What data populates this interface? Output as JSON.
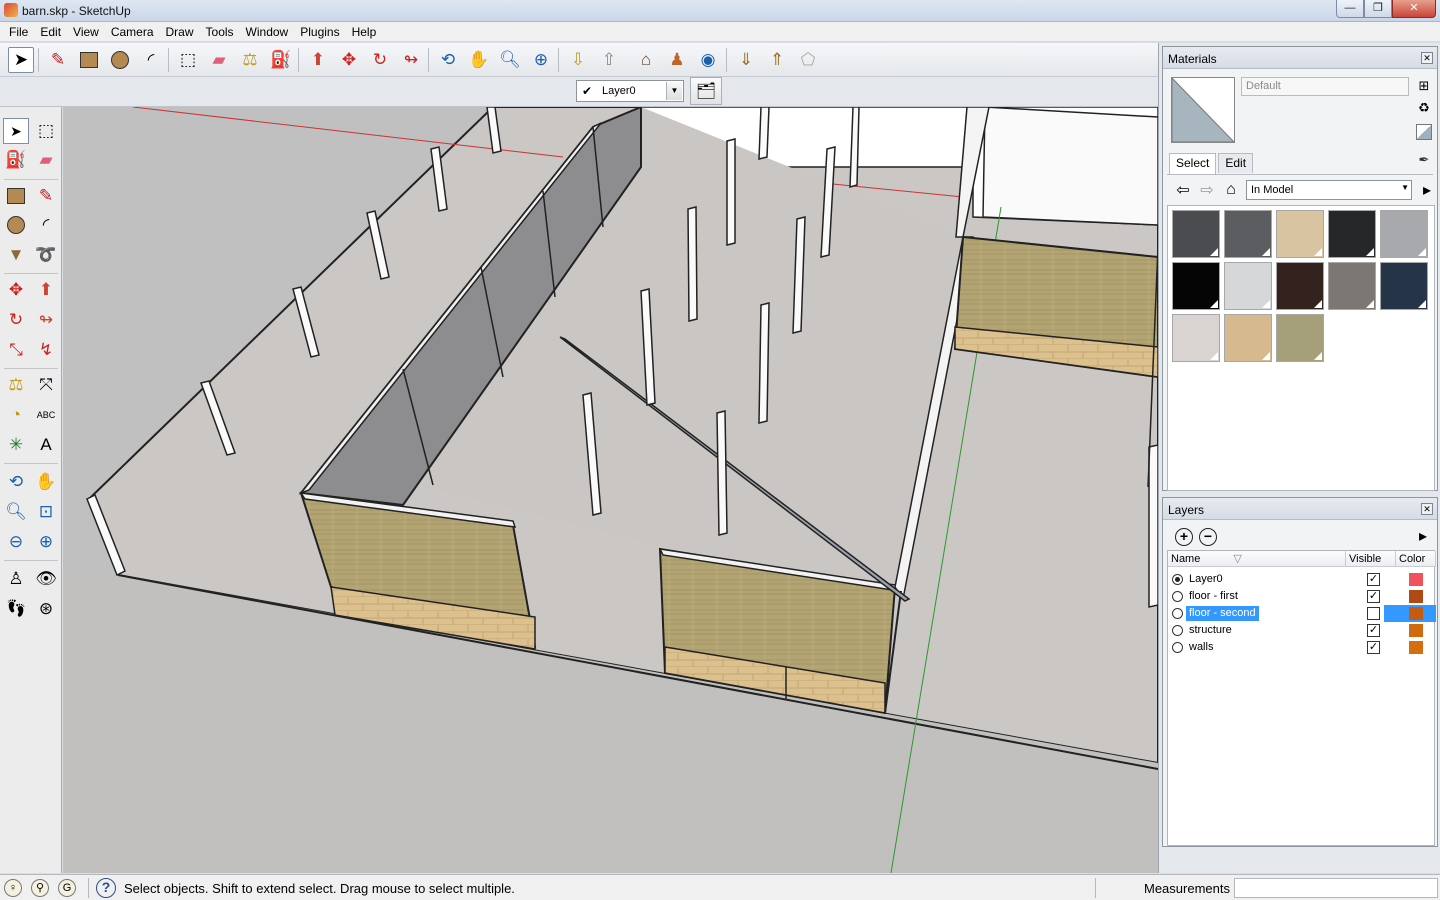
{
  "window": {
    "title": "barn.skp - SketchUp",
    "buttons": {
      "minimize": "—",
      "maximize": "❐",
      "close": "✕"
    }
  },
  "menu": [
    "File",
    "Edit",
    "View",
    "Camera",
    "Draw",
    "Tools",
    "Window",
    "Plugins",
    "Help"
  ],
  "toolbar": {
    "buttons": [
      {
        "name": "select-tool",
        "icon": "arrow"
      },
      {
        "name": "line-tool",
        "icon": "pencil"
      },
      {
        "name": "rectangle-tool",
        "icon": "rectangle"
      },
      {
        "name": "circle-tool",
        "icon": "circle"
      },
      {
        "name": "arc-tool",
        "icon": "arc"
      },
      {
        "name": "make-component-tool",
        "icon": "component"
      },
      {
        "name": "eraser-tool",
        "icon": "eraser"
      },
      {
        "name": "tape-measure-tool",
        "icon": "tape"
      },
      {
        "name": "paint-bucket-tool",
        "icon": "bucket"
      },
      {
        "name": "push-pull-tool",
        "icon": "push-pull"
      },
      {
        "name": "move-tool",
        "icon": "move"
      },
      {
        "name": "rotate-tool",
        "icon": "rotate"
      },
      {
        "name": "follow-me-tool",
        "icon": "follow-me"
      },
      {
        "name": "orbit-tool",
        "icon": "orbit"
      },
      {
        "name": "pan-tool",
        "icon": "hand"
      },
      {
        "name": "zoom-tool",
        "icon": "magnifier"
      },
      {
        "name": "zoom-extents-tool",
        "icon": "zoom-extents"
      },
      {
        "name": "get-models-button",
        "icon": "get-models"
      },
      {
        "name": "share-model-button",
        "icon": "share-model"
      },
      {
        "name": "add-location-button",
        "icon": "location"
      },
      {
        "name": "toggle-terrain-button",
        "icon": "terrain"
      },
      {
        "name": "preview-earth-button",
        "icon": "earth"
      },
      {
        "name": "get-components-button",
        "icon": "get-components"
      },
      {
        "name": "share-components-button",
        "icon": "share-components"
      },
      {
        "name": "extension-warehouse-button",
        "icon": "warehouse"
      }
    ]
  },
  "layer_toolbar": {
    "current_layer": "Layer0",
    "check": "✔"
  },
  "materials": {
    "title": "Materials",
    "name_field": "Default",
    "tabs": [
      "Select",
      "Edit"
    ],
    "active_tab": "Select",
    "library": "In Model",
    "swatches": [
      {
        "color": "#4a4c4f"
      },
      {
        "color": "#5b5d60"
      },
      {
        "color": "#d8c4a0"
      },
      {
        "color": "#262729"
      },
      {
        "color": "#a7a9ac"
      },
      {
        "color": "#050505"
      },
      {
        "color": "#d6d7d9"
      },
      {
        "color": "#33221e"
      },
      {
        "color": "#7d7773"
      },
      {
        "color": "#263447"
      },
      {
        "color": "#d9d4d2"
      },
      {
        "color": "#d6b98f"
      },
      {
        "color": "#a6a07a"
      }
    ]
  },
  "layers": {
    "title": "Layers",
    "columns": {
      "name": "Name",
      "visible": "Visible",
      "color": "Color"
    },
    "rows": [
      {
        "name": "Layer0",
        "current": true,
        "visible": true,
        "color": "#f1515a",
        "selected": false
      },
      {
        "name": "floor - first",
        "current": false,
        "visible": true,
        "color": "#b04a14",
        "selected": false
      },
      {
        "name": "floor - second",
        "current": false,
        "visible": false,
        "color": "#c65a10",
        "selected": true
      },
      {
        "name": "structure",
        "current": false,
        "visible": true,
        "color": "#cf6a10",
        "selected": false
      },
      {
        "name": "walls",
        "current": false,
        "visible": true,
        "color": "#d46f10",
        "selected": false
      }
    ]
  },
  "status": {
    "message": "Select objects. Shift to extend select. Drag mouse to select multiple.",
    "help_icon": "?",
    "measurements_label": "Measurements",
    "measurements_value": ""
  }
}
